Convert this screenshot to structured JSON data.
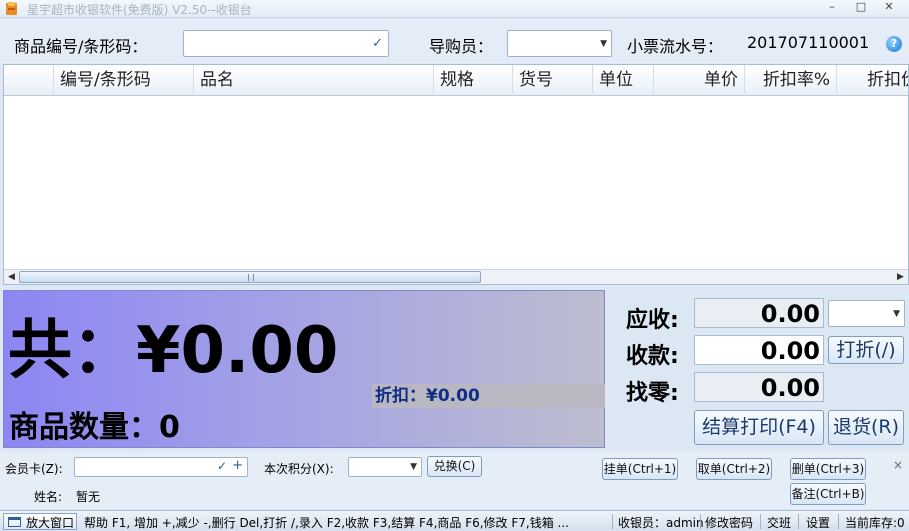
{
  "window": {
    "title": "星宇超市收银软件(免费版) V2.50--收银台",
    "minimize": "–",
    "maximize": "□",
    "close": "✕"
  },
  "search": {
    "code_label": "商品编号/条形码：",
    "code_value": "",
    "guide_label": "导购员：",
    "guide_value": "",
    "receipt_label": "小票流水号：",
    "receipt_no": "201707110001",
    "help_glyph": "?"
  },
  "grid": {
    "columns": [
      "编号/条形码",
      "品名",
      "规格",
      "货号",
      "单位",
      "单价",
      "折扣率%",
      "折扣价"
    ],
    "rows": []
  },
  "totals": {
    "total_text": "共：¥0.00",
    "discount_text": "折扣：¥0.00",
    "quantity_text": "商品数量：0"
  },
  "payment": {
    "receivable_label": "应收:",
    "receivable_value": "0.00",
    "received_label": "收款:",
    "received_value": "0.00",
    "change_label": "找零:",
    "change_value": "0.00",
    "discount_select_value": "",
    "discount_button": "打折(/)",
    "checkout_button": "结算打印(F4)",
    "refund_button": "退货(R)"
  },
  "member": {
    "card_label": "会员卡(Z):",
    "card_value": "",
    "points_label": "本次积分(X):",
    "points_value": "",
    "redeem_button": "兑换(C)",
    "name_label": "姓名:",
    "name_value": "暂无",
    "hang_button": "挂单(Ctrl+1)",
    "take_button": "取单(Ctrl+2)",
    "delete_button": "删单(Ctrl+3)",
    "note_button": "备注(Ctrl+B)",
    "close_glyph": "×"
  },
  "statusbar": {
    "enlarge": "放大窗口",
    "help_text": "帮助 F1, 增加 +,减少 -,删行 Del,打折 /,录入 F2,收款 F3,结算 F4,商品 F6,修改 F7,钱箱 ...",
    "cashier": "收银员：admin",
    "change_password": "修改密码",
    "handover": "交班",
    "settings": "设置",
    "stock": "当前库存:0"
  }
}
